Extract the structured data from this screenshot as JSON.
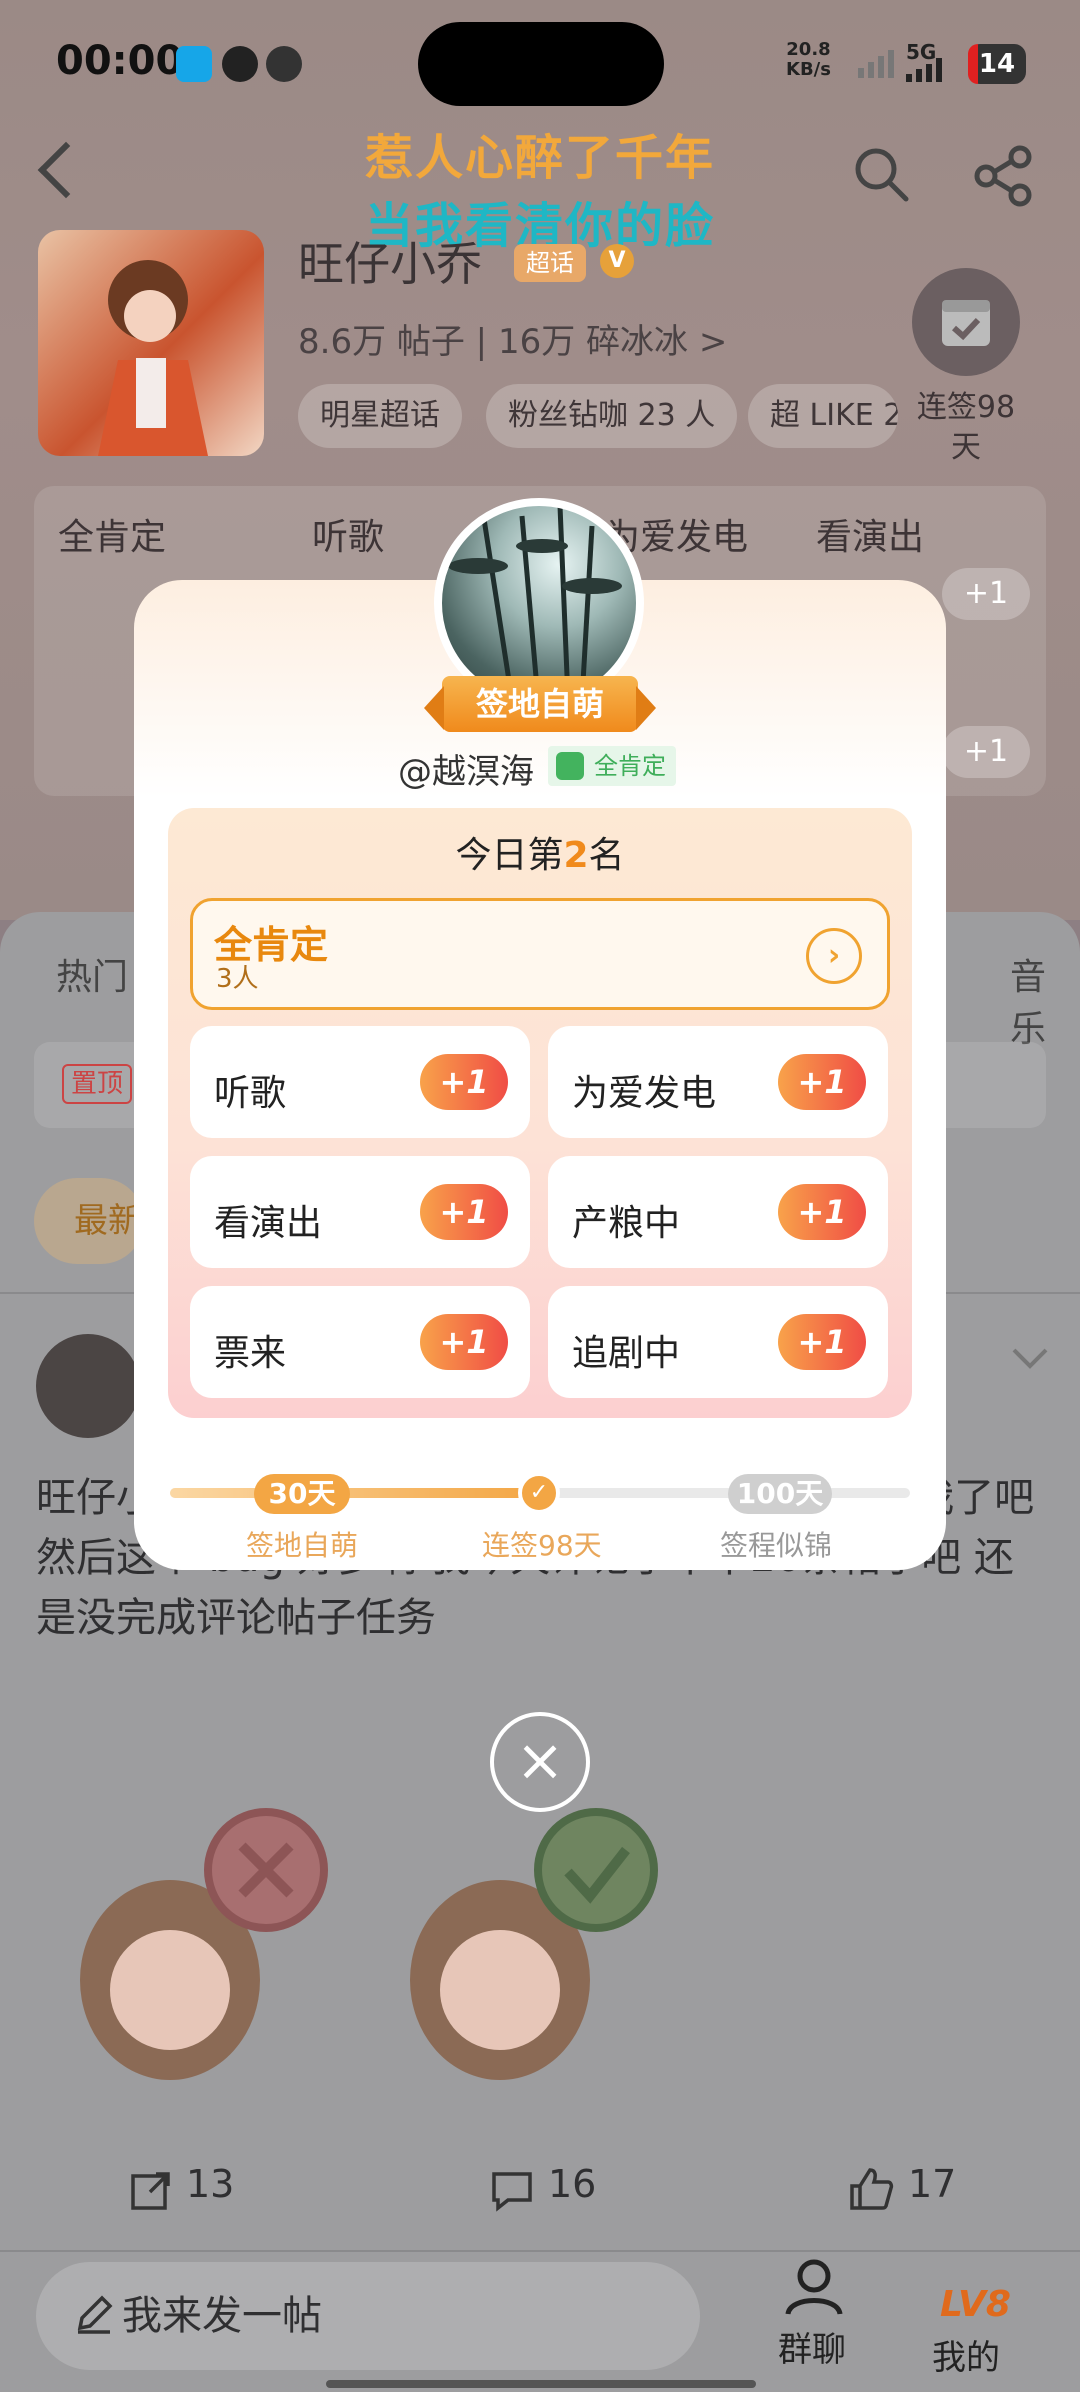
{
  "status_bar": {
    "time": "00:00",
    "net_speed_value": "20.8",
    "net_speed_unit": "KB/s",
    "network": "5G",
    "battery": "14"
  },
  "lyrics": {
    "line1": "惹人心醉了千年",
    "line2": "当我看清你的脸"
  },
  "community": {
    "name": "旺仔小乔",
    "badge": "超话",
    "v_badge": "V",
    "stats": "8.6万 帖子 | 16万 碎冰冰 >",
    "chips": [
      "明星超话",
      "粉丝钻咖 23 人",
      "超 LIKE 2"
    ],
    "sign_label": "连签98天",
    "card_titles": [
      "全肯定",
      "听歌",
      "为爱发电",
      "看演出"
    ],
    "card_plus": [
      "+1",
      "+1"
    ]
  },
  "feed": {
    "tabs": [
      "热门",
      "音乐"
    ],
    "pin_label": "置顶",
    "newest_label": "最新",
    "post_text": "旺仔小乔家喜欢呀 祝 为什么发到微博不透明了 沉我了吧 然后这个 bug 好多啊 我今天评论了不下20条帖子吧 还是没完成评论帖子任务",
    "actions": {
      "share": "13",
      "comment": "16",
      "like": "17"
    }
  },
  "bottom": {
    "post_button": "我来发一帖",
    "group_chat": "群聊",
    "mine": "我的",
    "level": "LV8"
  },
  "modal": {
    "title_badge": "签地自萌",
    "username": "@越溟海",
    "tag": "全肯定",
    "rank_prefix": "今日第",
    "rank_num": "2",
    "rank_suffix": "名",
    "all_affirm": {
      "label": "全肯定",
      "count": "3人"
    },
    "tiles": [
      {
        "label": "听歌",
        "plus": "+1"
      },
      {
        "label": "为爱发电",
        "plus": "+1"
      },
      {
        "label": "看演出",
        "plus": "+1"
      },
      {
        "label": "产粮中",
        "plus": "+1"
      },
      {
        "label": "票来",
        "plus": "+1"
      },
      {
        "label": "追剧中",
        "plus": "+1"
      }
    ],
    "progress": {
      "start_pill": "30天",
      "start_label": "签地自萌",
      "current_label": "连签98天",
      "end_pill": "100天",
      "end_label": "签程似锦",
      "fraction": 0.5
    },
    "close": "×"
  },
  "colors": {
    "accent": "#f08a1c",
    "plus_start": "#f8a24a",
    "plus_end": "#f04d45"
  }
}
